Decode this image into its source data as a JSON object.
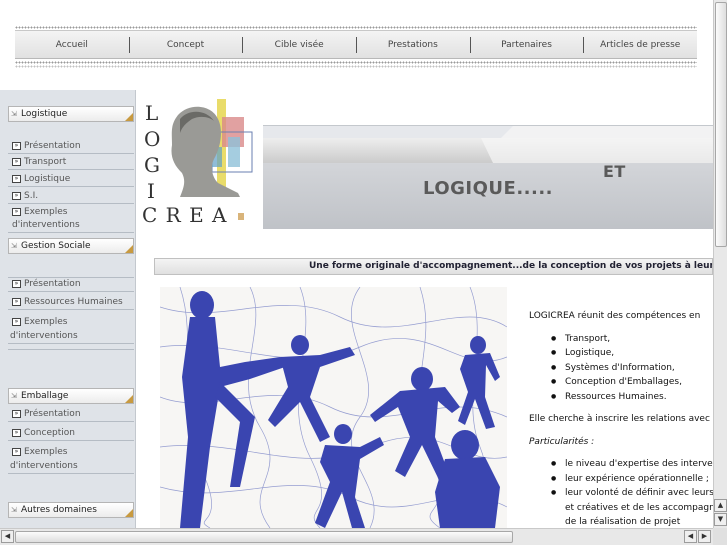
{
  "nav": {
    "items": [
      "Accueil",
      "Concept",
      "Cible visée",
      "Prestations",
      "Partenaires",
      "Articles de presse"
    ]
  },
  "sidebar": {
    "sections": [
      {
        "title": "Logistique",
        "items": [
          "Présentation",
          "Transport",
          "Logistique",
          "S.I.",
          "Exemples d'interventions"
        ]
      },
      {
        "title": "Gestion Sociale",
        "items": [
          "Présentation",
          "Ressources Humaines",
          "Exemples",
          "d'interventions"
        ]
      },
      {
        "title": "Emballage",
        "items": [
          "Présentation",
          "Conception",
          "Exemples",
          "d'interventions"
        ]
      },
      {
        "title": "Autres domaines"
      }
    ]
  },
  "logo": {
    "col": [
      "L",
      "O",
      "G",
      "I"
    ],
    "row": "C R E A"
  },
  "banner": {
    "left_text": "LOGIQUE.....",
    "right_text": "ET"
  },
  "tagline": "Une forme originale d'accompagnement...de la conception de vos projets à leur réalisation",
  "content": {
    "intro": "LOGICREA réunit des compétences en",
    "competences": [
      "Transport,",
      "Logistique,",
      "Systèmes d'Information,",
      "Conception d'Emballages,",
      "Ressources Humaines."
    ],
    "relation": "Elle cherche à inscrire les relations avec s",
    "particularites_label": "Particularités :",
    "particularites": [
      "le niveau d'expertise des interven",
      "leur expérience opérationnelle ;",
      "leur volonté de définir avec leurs c"
    ],
    "continuation": [
      "et créatives et de les accompagne",
      "de la réalisation de projet"
    ]
  },
  "colors": {
    "accent_corner": "#c89a40",
    "painting_blue": "#3a45b0"
  }
}
